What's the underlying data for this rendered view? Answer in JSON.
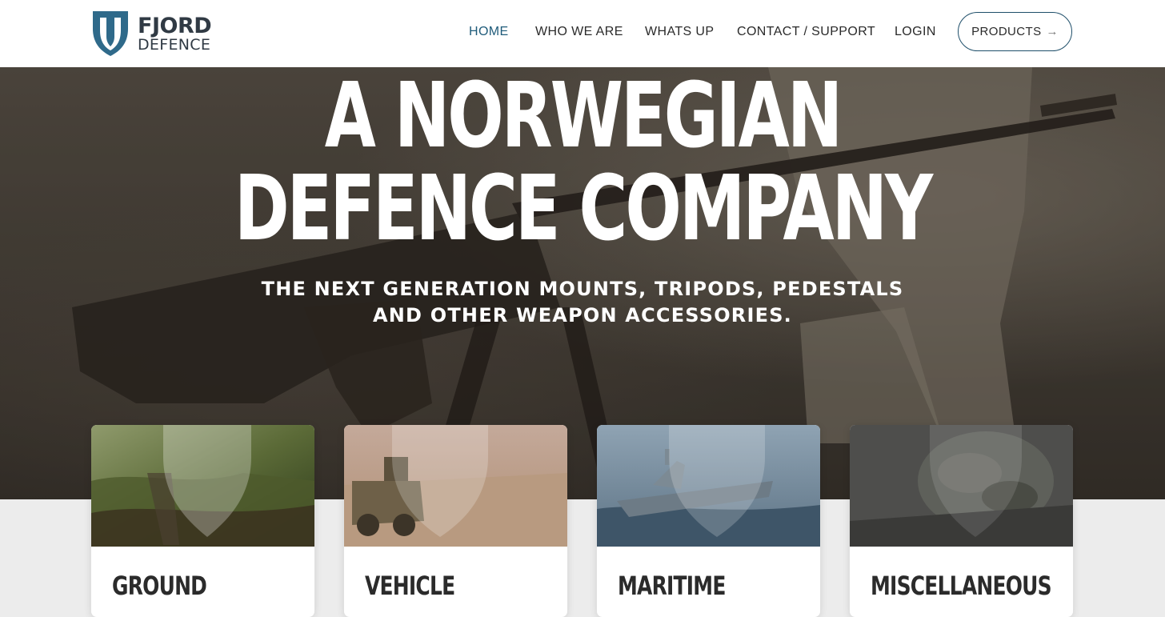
{
  "logo": {
    "line1": "FJORD",
    "line2": "DEFENCE",
    "icon": "fjord-shield-logo"
  },
  "colors": {
    "brand": "#1f5b7a",
    "nav_text": "#2a2a2a",
    "hero_text": "#ffffff"
  },
  "nav": {
    "items": [
      {
        "label": "HOME",
        "active": true
      },
      {
        "label": "WHO WE ARE",
        "active": false
      },
      {
        "label": "WHATS UP",
        "active": false
      },
      {
        "label": "CONTACT / SUPPORT",
        "active": false
      },
      {
        "label": "LOGIN",
        "active": false
      }
    ],
    "products": {
      "label": "PRODUCTS",
      "icon": "arrow-right-icon"
    }
  },
  "hero": {
    "title_line1": "A NORWEGIAN",
    "title_line2": "DEFENCE COMPANY",
    "subtitle_line1": "THE NEXT GENERATION MOUNTS, TRIPODS, PEDESTALS",
    "subtitle_line2": "AND OTHER WEAPON ACCESSORIES."
  },
  "categories": [
    {
      "label": "GROUND",
      "image": "soldiers-landscape"
    },
    {
      "label": "VEHICLE",
      "image": "armored-vehicle-desert"
    },
    {
      "label": "MARITIME",
      "image": "warship-sea"
    },
    {
      "label": "MISCELLANEOUS",
      "image": "helmet-camouflage"
    }
  ]
}
